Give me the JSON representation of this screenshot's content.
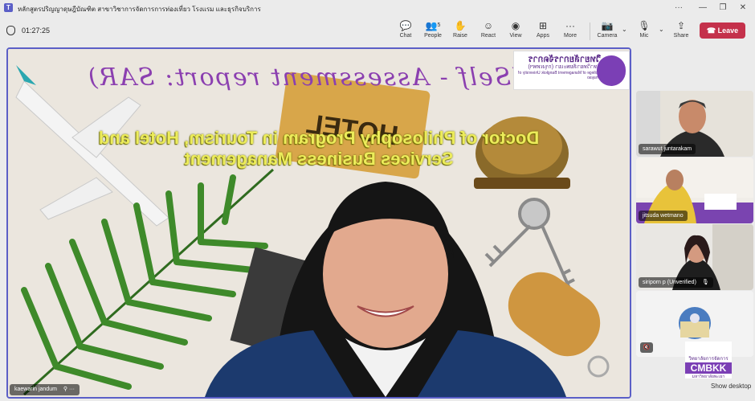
{
  "window": {
    "app_icon": "teams-icon",
    "title": "หลักสูตรปริญญาดุษฎีบัณฑิต สาขาวิชาการจัดการการท่องเที่ยว โรงแรม และธุรกิจบริการ",
    "controls": {
      "more": "···",
      "minimize": "—",
      "restore": "❐",
      "close": "✕"
    }
  },
  "toolbar": {
    "timer": "01:27:25",
    "chat": "Chat",
    "people": "People",
    "people_count": "5",
    "raise": "Raise",
    "react": "React",
    "view": "View",
    "apps": "Apps",
    "more": "More",
    "camera": "Camera",
    "mic": "Mic",
    "share": "Share",
    "leave": "Leave",
    "icons": {
      "chat": "💬",
      "people": "👥",
      "raise": "✋",
      "react": "☺",
      "view": "◉",
      "apps": "⊞",
      "more": "···",
      "camera": "📷",
      "mic": "🎙",
      "share": "⇪",
      "leave": "☎",
      "chevron": "⌄"
    }
  },
  "main_video": {
    "slide_title": "(Self - Assessment report: SAR)",
    "program_line1": "Doctor of Philosophy Program in Tourism, Hotel and",
    "program_line2": "Services Business Management",
    "hotel_sign": "HOTEL",
    "logo_thai_1": "วิทยาลัยการจัดการ",
    "logo_thai_2": "มหาวิทยาลัยพะเยา (กรุงเทพฯ)",
    "logo_en": "College of Management Bangkok University of Phayao",
    "speaker_name": "kaewarin jandum",
    "speaker_icons": "⚲ ···"
  },
  "participants": [
    {
      "name": "sarawut juntarakam"
    },
    {
      "name": "jitsuda wetmano"
    },
    {
      "name": "siriporn p (Unverified)",
      "mic_icon": "🎙"
    },
    {
      "name": "",
      "mic_icon": "🔇"
    }
  ],
  "cmbkk_logo": {
    "thai_top": "วิทยาลัยการจัดการ",
    "name": "CMBKK",
    "thai_bottom": "มหาวิทยาลัยพะเยา"
  },
  "show_desktop": "Show desktop",
  "colors": {
    "accent": "#5b5fc7",
    "leave": "#c4314b",
    "slide_title": "#8b3fb0",
    "program_text": "#ecec5a"
  }
}
